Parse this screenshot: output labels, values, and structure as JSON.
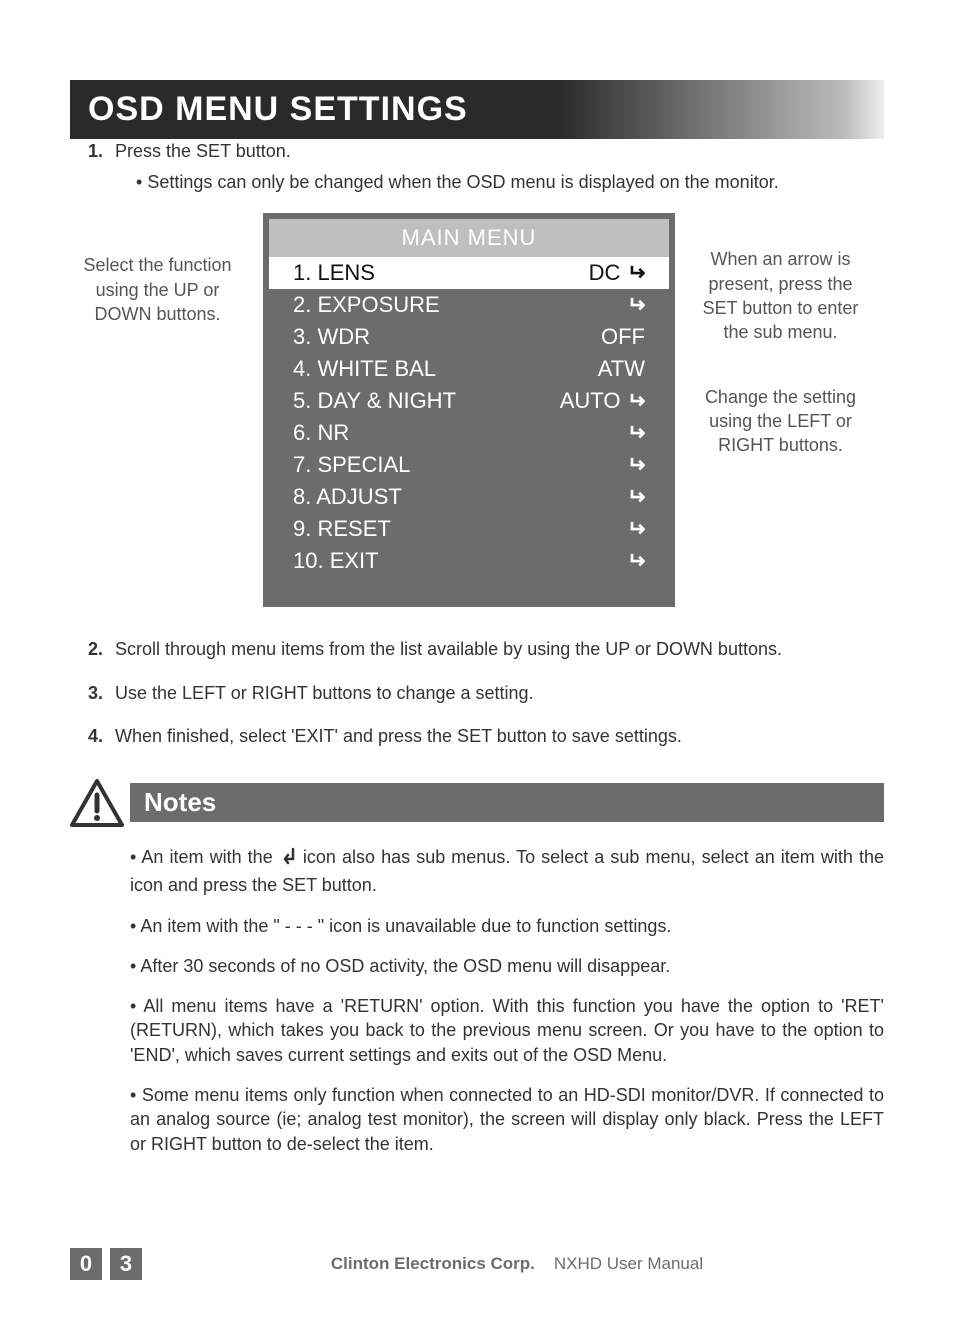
{
  "title": "OSD MENU SETTINGS",
  "steps": {
    "s1_num": "1.",
    "s1_text": "Press the SET button.",
    "s1_sub": "Settings can only be changed when the OSD menu is displayed on the monitor.",
    "s2_num": "2.",
    "s2_text": "Scroll through menu items from the list available by using the UP or DOWN buttons.",
    "s3_num": "3.",
    "s3_text": "Use the LEFT or RIGHT buttons to change a setting.",
    "s4_num": "4.",
    "s4_text": "When finished, select 'EXIT' and press the SET button to save settings."
  },
  "left_note": "Select the function using the UP or DOWN buttons.",
  "right_note_1": "When an arrow is present, press the SET button to enter the sub menu.",
  "right_note_2": "Change the setting using the LEFT or RIGHT buttons.",
  "menu": {
    "title": "MAIN MENU",
    "items": [
      {
        "label": "1. LENS",
        "value": "DC",
        "has_enter": true,
        "selected": true
      },
      {
        "label": "2. EXPOSURE",
        "value": "",
        "has_enter": true,
        "selected": false
      },
      {
        "label": "3. WDR",
        "value": "OFF",
        "has_enter": false,
        "selected": false
      },
      {
        "label": "4. WHITE BAL",
        "value": "ATW",
        "has_enter": false,
        "selected": false
      },
      {
        "label": "5. DAY & NIGHT",
        "value": "AUTO",
        "has_enter": true,
        "selected": false
      },
      {
        "label": "6. NR",
        "value": "",
        "has_enter": true,
        "selected": false
      },
      {
        "label": "7. SPECIAL",
        "value": "",
        "has_enter": true,
        "selected": false
      },
      {
        "label": "8. ADJUST",
        "value": "",
        "has_enter": true,
        "selected": false
      },
      {
        "label": "9. RESET",
        "value": "",
        "has_enter": true,
        "selected": false
      },
      {
        "label": "10. EXIT",
        "value": "",
        "has_enter": true,
        "selected": false
      }
    ]
  },
  "notes_header": "Notes",
  "notes": {
    "n1a": "An item with the ",
    "n1b": " icon also has sub menus.  To select a sub menu, select an item with the icon and press the SET button.",
    "n2": "An item with the \" - - - \" icon is unavailable due to function settings.",
    "n3": "After 30 seconds of no OSD activity, the OSD menu will disappear.",
    "n4": "All menu items have a 'RETURN' option. With this function you have the option to 'RET' (RETURN), which takes you back to the previous menu screen. Or you have to the option to 'END', which saves current settings and exits out of the OSD Menu.",
    "n5": "Some menu items only function when connected to an HD-SDI monitor/DVR. If connected to an analog source (ie; analog test monitor), the screen will display only black. Press the LEFT or RIGHT button to de-select the item."
  },
  "footer": {
    "page_d1": "0",
    "page_d2": "3",
    "company": "Clinton Electronics Corp.",
    "doc": "NXHD User Manual"
  }
}
